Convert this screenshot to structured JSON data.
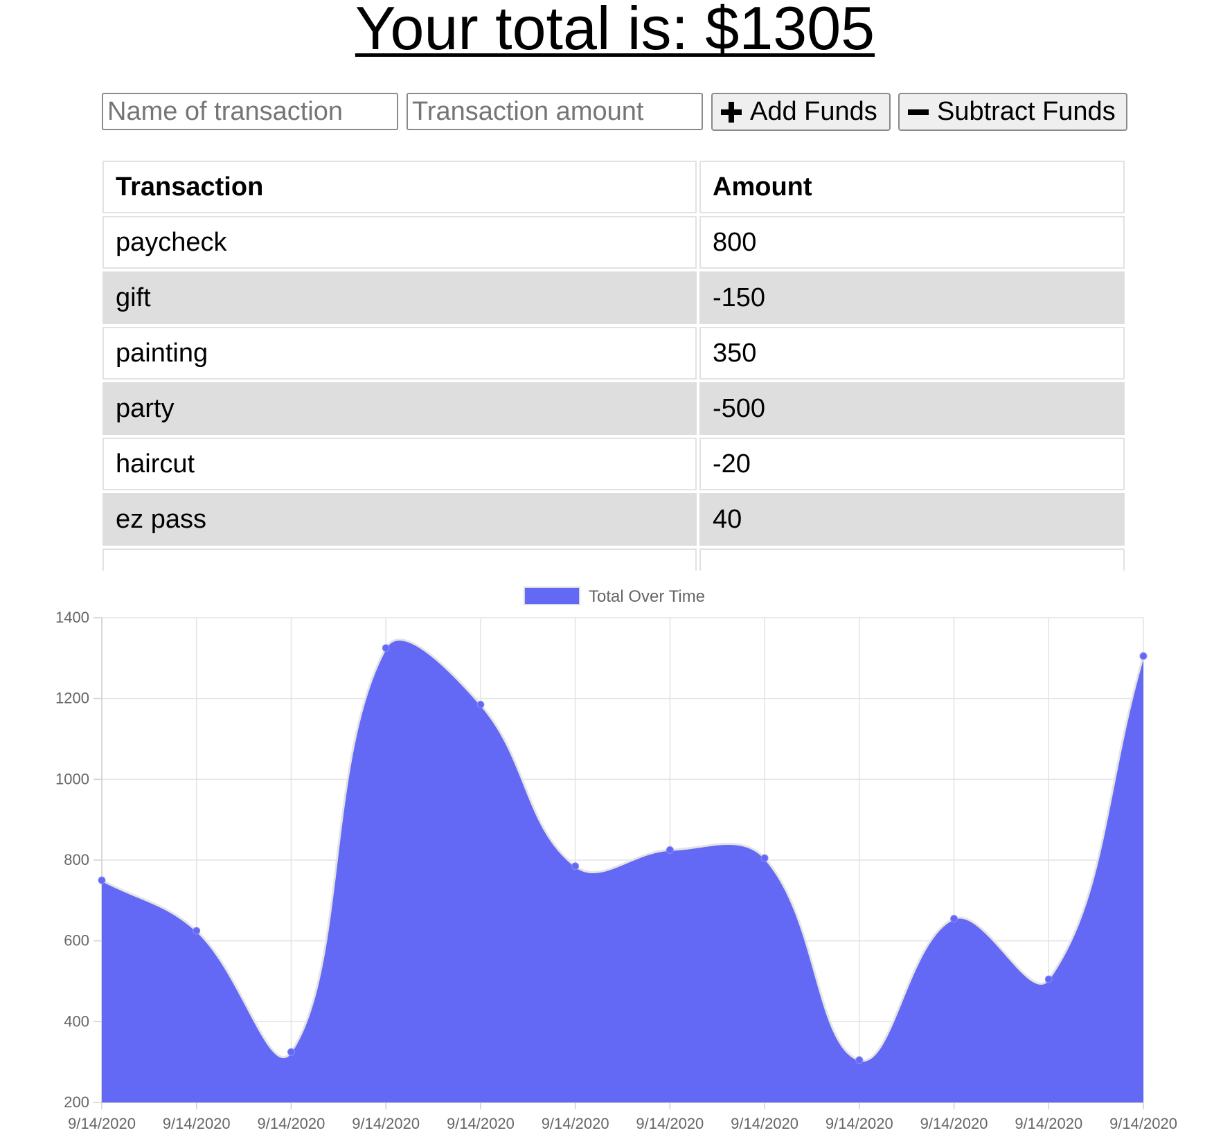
{
  "header": {
    "title": "Your total is: $1305"
  },
  "form": {
    "name_placeholder": "Name of transaction",
    "amount_placeholder": "Transaction amount",
    "add_label": "Add Funds",
    "subtract_label": "Subtract Funds"
  },
  "table": {
    "headers": [
      "Transaction",
      "Amount"
    ],
    "rows": [
      {
        "name": "paycheck",
        "amount": "800"
      },
      {
        "name": "gift",
        "amount": "-150"
      },
      {
        "name": "painting",
        "amount": "350"
      },
      {
        "name": "party",
        "amount": "-500"
      },
      {
        "name": "haircut",
        "amount": "-20"
      },
      {
        "name": "ez pass",
        "amount": "40"
      }
    ]
  },
  "chart_data": {
    "type": "area",
    "legend": "Total Over Time",
    "categories": [
      "9/14/2020",
      "9/14/2020",
      "9/14/2020",
      "9/14/2020",
      "9/14/2020",
      "9/14/2020",
      "9/14/2020",
      "9/14/2020",
      "9/14/2020",
      "9/14/2020",
      "9/14/2020",
      "9/14/2020"
    ],
    "series": [
      {
        "name": "Total Over Time",
        "values": [
          750,
          625,
          325,
          1325,
          1185,
          785,
          825,
          805,
          305,
          655,
          505,
          1305
        ]
      }
    ],
    "ylim": [
      200,
      1400
    ],
    "yticks": [
      200,
      400,
      600,
      800,
      1000,
      1200,
      1400
    ],
    "grid": true,
    "legend_position": "top",
    "fill_color": "#6369f4",
    "point_color": "#6369f4",
    "line_color": "#e4e4e4"
  }
}
